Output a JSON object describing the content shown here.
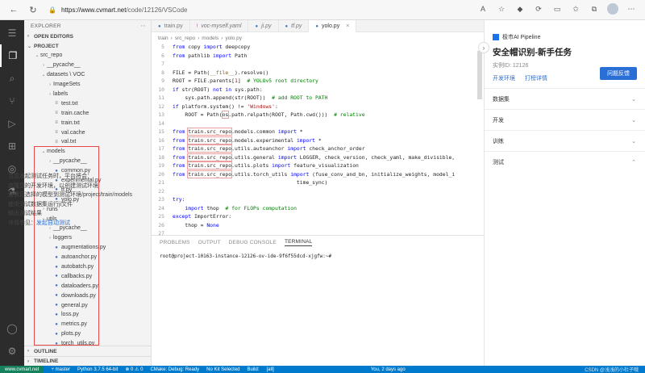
{
  "browser": {
    "url_host": "https://www.cvmart.net",
    "url_path": "/code/12126/VSCode"
  },
  "sidebar": {
    "title": "EXPLORER",
    "open_editors": "OPEN EDITORS",
    "project": "PROJECT",
    "tree": [
      {
        "label": "src_repo",
        "depth": 1,
        "type": "folder-open"
      },
      {
        "label": "__pycache__",
        "depth": 2,
        "type": "folder"
      },
      {
        "label": "datasets \\ VOC",
        "depth": 2,
        "type": "folder-open"
      },
      {
        "label": "ImageSets",
        "depth": 3,
        "type": "folder"
      },
      {
        "label": "labels",
        "depth": 3,
        "type": "folder"
      },
      {
        "label": "test.txt",
        "depth": 3,
        "type": "txt"
      },
      {
        "label": "train.cache",
        "depth": 3,
        "type": "txt"
      },
      {
        "label": "train.txt",
        "depth": 3,
        "type": "txt"
      },
      {
        "label": "val.cache",
        "depth": 3,
        "type": "txt"
      },
      {
        "label": "val.txt",
        "depth": 3,
        "type": "txt"
      },
      {
        "label": "models",
        "depth": 2,
        "type": "folder-open"
      },
      {
        "label": "__pycache__",
        "depth": 3,
        "type": "folder"
      },
      {
        "label": "common.py",
        "depth": 3,
        "type": "py"
      },
      {
        "label": "experimental.py",
        "depth": 3,
        "type": "py"
      },
      {
        "label": "tf.py",
        "depth": 3,
        "type": "py"
      },
      {
        "label": "yolo.py",
        "depth": 3,
        "type": "py"
      },
      {
        "label": "runs",
        "depth": 2,
        "type": "folder"
      },
      {
        "label": "utils",
        "depth": 2,
        "type": "folder-open"
      },
      {
        "label": "__pycache__",
        "depth": 3,
        "type": "folder"
      },
      {
        "label": "loggers",
        "depth": 3,
        "type": "folder"
      },
      {
        "label": "augmentations.py",
        "depth": 3,
        "type": "py"
      },
      {
        "label": "autoanchor.py",
        "depth": 3,
        "type": "py"
      },
      {
        "label": "autobatch.py",
        "depth": 3,
        "type": "py"
      },
      {
        "label": "callbacks.py",
        "depth": 3,
        "type": "py"
      },
      {
        "label": "dataloaders.py",
        "depth": 3,
        "type": "py"
      },
      {
        "label": "downloads.py",
        "depth": 3,
        "type": "py"
      },
      {
        "label": "general.py",
        "depth": 3,
        "type": "py"
      },
      {
        "label": "loss.py",
        "depth": 3,
        "type": "py"
      },
      {
        "label": "metrics.py",
        "depth": 3,
        "type": "py"
      },
      {
        "label": "plots.py",
        "depth": 3,
        "type": "py"
      },
      {
        "label": "torch_utils.py",
        "depth": 3,
        "type": "py"
      }
    ],
    "outline": "OUTLINE",
    "timeline": "TIMELINE"
  },
  "tabs": [
    {
      "label": "train.py",
      "italic": false,
      "active": false
    },
    {
      "label": "voc-myself.yaml",
      "italic": true,
      "active": false
    },
    {
      "label": "ji.py",
      "italic": true,
      "active": false
    },
    {
      "label": "tf.py",
      "italic": true,
      "active": false
    },
    {
      "label": "yolo.py",
      "italic": false,
      "active": true
    }
  ],
  "breadcrumb": [
    "train",
    "src_repo",
    "models",
    "yolo.py"
  ],
  "code": [
    {
      "n": "5",
      "html": "<span class=\"kw\">from</span> copy <span class=\"kw\">import</span> deepcopy"
    },
    {
      "n": "6",
      "html": "<span class=\"kw\">from</span> pathlib <span class=\"kw\">import</span> Path"
    },
    {
      "n": "7",
      "html": ""
    },
    {
      "n": "8",
      "html": "FILE = Path(<span class=\"fn\">__file__</span>).resolve()"
    },
    {
      "n": "9",
      "html": "ROOT = FILE.parents[<span class=\"st\">1</span>]  <span class=\"cm\"># YOLOv5 root directory</span>"
    },
    {
      "n": "10",
      "html": "<span class=\"kw\">if</span> str(ROOT) <span class=\"kw\">not in</span> sys.path:"
    },
    {
      "n": "11",
      "html": "    sys.path.append(str(ROOT))  <span class=\"cm\"># add ROOT to PATH</span>"
    },
    {
      "n": "12",
      "html": "<span class=\"kw\">if</span> platform.system() != <span class=\"st\">'Windows'</span>:"
    },
    {
      "n": "13",
      "html": "    ROOT = Path(<span class=\"hl\">os</span>.path.relpath(ROOT, Path.cwd()))  <span class=\"cm\"># relative</span>"
    },
    {
      "n": "14",
      "html": ""
    },
    {
      "n": "15",
      "html": "<span class=\"kw\">from</span> <span class=\"hl\">train.src_repo</span>.models.common <span class=\"kw\">import</span> *"
    },
    {
      "n": "16",
      "html": "<span class=\"kw\">from</span> <span class=\"hl\">train.src_repo</span>.models.experimental <span class=\"kw\">import</span> *"
    },
    {
      "n": "17",
      "html": "<span class=\"kw\">from</span> <span class=\"hl\">train.src_repo</span>.utils.autoanchor <span class=\"kw\">import</span> check_anchor_order"
    },
    {
      "n": "18",
      "html": "<span class=\"kw\">from</span> <span class=\"hl\">train.src_repo</span>.utils.general <span class=\"kw\">import</span> LOGGER, check_version, check_yaml, make_divisible,"
    },
    {
      "n": "19",
      "html": "<span class=\"kw\">from</span> <span class=\"hl\">train.src_repo</span>.utils.plots <span class=\"kw\">import</span> feature_visualization"
    },
    {
      "n": "20",
      "html": "<span class=\"kw\">from</span> <span class=\"hl\">train.src_repo</span>.utils.torch_utils <span class=\"kw\">import</span> (fuse_conv_and_bn, initialize_weights, model_i"
    },
    {
      "n": "21",
      "html": "                                        time_sync)"
    },
    {
      "n": "22",
      "html": ""
    },
    {
      "n": "23",
      "html": "<span class=\"kw\">try</span>:"
    },
    {
      "n": "24",
      "html": "    <span class=\"kw\">import</span> thop  <span class=\"cm\"># for FLOPs computation</span>"
    },
    {
      "n": "25",
      "html": "<span class=\"kw\">except</span> ImportError:"
    },
    {
      "n": "26",
      "html": "    thop = <span class=\"kw\">None</span>"
    },
    {
      "n": "27",
      "html": ""
    }
  ],
  "panel": {
    "tabs": [
      "PROBLEMS",
      "OUTPUT",
      "DEBUG CONSOLE",
      "TERMINAL"
    ],
    "active_tab": "TERMINAL",
    "terminal_line": "root@project-10163-instance-12126-ov-ide-9f6f55dcd-xjgfw:~#"
  },
  "task": {
    "header": "极市AI Pipeline",
    "title": "安全帽识别-新手任务",
    "id_text": "实例ID: 12126",
    "link1": "开发环境",
    "link2": "打榜详情",
    "button": "问题反馈",
    "sections": [
      "数据集",
      "开发",
      "训练",
      "测试"
    ],
    "test_body": [
      "当您发起测试任务时，平台将会：",
      "克隆您的开发环境，以创建测试环境",
      "替换您选择的模型到测试环境/project/train/models",
      "使用测试数据集运行ji文件",
      "输出测试结果"
    ],
    "detail_prefix": "详情参见：",
    "detail_link": "发起自动测试"
  },
  "status": {
    "remote": "www.cvmart.net",
    "branch": "master",
    "python": "Python 3.7.5 64-bit",
    "problems": "⊗ 0  ⚠ 0",
    "cmake": "CMake: Debug: Ready",
    "kit": "No Kit Selected",
    "build": "Build:",
    "all": "[all]",
    "git": "You, 2 days ago",
    "watermark": "CSDN @浅浅的小杜子哦"
  }
}
